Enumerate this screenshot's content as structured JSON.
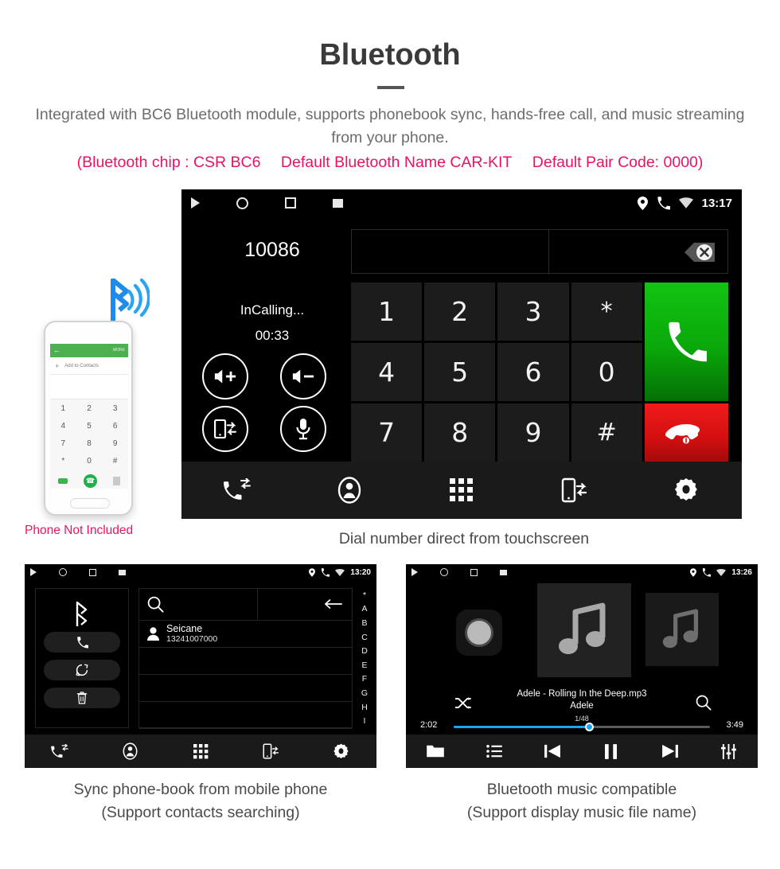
{
  "header": {
    "title": "Bluetooth",
    "subtitle": "Integrated with BC6 Bluetooth module, supports phonebook sync, hands-free call, and music streaming from your phone.",
    "spec_open": "(Bluetooth chip : CSR BC6",
    "spec_name": "Default Bluetooth Name CAR-KIT",
    "spec_pair": "Default Pair Code: 0000)",
    "accent_color": "#ec1164",
    "text_color": "#6d6d6d"
  },
  "captions": {
    "main": "Dial number direct from touchscreen",
    "phone_not_included": "Phone Not Included",
    "left_line1": "Sync phone-book from mobile phone",
    "left_line2": "(Support contacts searching)",
    "right_line1": "Bluetooth music compatible",
    "right_line2": "(Support display music file name)"
  },
  "dialer": {
    "status": {
      "time": "13:17",
      "icons": [
        "back-icon",
        "home-icon",
        "recents-icon",
        "screenshot-icon"
      ],
      "tray": [
        "location-icon",
        "phone-icon",
        "wifi-icon"
      ]
    },
    "caller_number": "10086",
    "call_state": "InCalling...",
    "call_timer": "00:33",
    "controls": [
      {
        "name": "volume-up-button",
        "icon": "speaker-plus-icon"
      },
      {
        "name": "volume-down-button",
        "icon": "speaker-minus-icon"
      },
      {
        "name": "transfer-to-phone-button",
        "icon": "phone-transfer-icon"
      },
      {
        "name": "mute-microphone-button",
        "icon": "microphone-icon"
      }
    ],
    "input_value": "",
    "backspace_label": "backspace-icon",
    "keys": [
      "1",
      "2",
      "3",
      "*",
      "4",
      "5",
      "6",
      "0",
      "7",
      "8",
      "9",
      "#"
    ],
    "call_button": "call-icon",
    "end_button": "end-call-icon",
    "tabs": [
      {
        "name": "tab-call-log",
        "icon": "call-log-icon"
      },
      {
        "name": "tab-contacts",
        "icon": "contact-icon"
      },
      {
        "name": "tab-keypad",
        "icon": "keypad-icon"
      },
      {
        "name": "tab-sync",
        "icon": "sync-device-icon"
      },
      {
        "name": "tab-settings",
        "icon": "gear-icon"
      }
    ]
  },
  "phone_illustration": {
    "topbar_back": "back-arrow-icon",
    "topbar_more": "MORE",
    "add_contact": "Add to Contacts",
    "keys": [
      "1",
      "2",
      "3",
      "4",
      "5",
      "6",
      "7",
      "8",
      "9",
      "*",
      "0",
      "#"
    ],
    "bt_icon": "bluetooth-signal-icon"
  },
  "phonebook": {
    "status": {
      "time": "13:20",
      "icons": [
        "back-icon",
        "home-icon",
        "recents-icon",
        "screenshot-icon"
      ],
      "tray": [
        "location-icon",
        "phone-icon",
        "wifi-icon"
      ]
    },
    "side_buttons": [
      {
        "name": "bluetooth-status-icon",
        "icon": "bluetooth-icon"
      },
      {
        "name": "dial-button",
        "icon": "phone-icon"
      },
      {
        "name": "sync-contacts-button",
        "icon": "refresh-icon"
      },
      {
        "name": "delete-contacts-button",
        "icon": "trash-icon"
      }
    ],
    "search_placeholder": "",
    "search_icon": "search-icon",
    "back_icon": "arrow-left-icon",
    "contacts": [
      {
        "name": "Seicane",
        "number": "13241007000"
      }
    ],
    "empty_rows": 3,
    "index": [
      "*",
      "A",
      "B",
      "C",
      "D",
      "E",
      "F",
      "G",
      "H",
      "I"
    ],
    "tabs": [
      {
        "name": "tab-call-log",
        "icon": "call-log-icon"
      },
      {
        "name": "tab-contacts",
        "icon": "contact-icon"
      },
      {
        "name": "tab-keypad",
        "icon": "keypad-icon"
      },
      {
        "name": "tab-sync",
        "icon": "sync-device-icon"
      },
      {
        "name": "tab-settings",
        "icon": "gear-icon"
      }
    ]
  },
  "music": {
    "status": {
      "time": "13:26",
      "icons": [
        "back-icon",
        "home-icon",
        "recents-icon",
        "screenshot-icon"
      ],
      "tray": [
        "location-icon",
        "phone-icon",
        "wifi-icon"
      ]
    },
    "track_title": "Adele - Rolling In the Deep.mp3",
    "artist": "Adele",
    "track_count": "1/48",
    "elapsed": "2:02",
    "total": "3:49",
    "progress_percent": 53,
    "progress_color": "#19a4f5",
    "shuffle_icon": "shuffle-icon",
    "search_icon": "search-icon",
    "tabs": [
      {
        "name": "tab-folder",
        "icon": "folder-icon"
      },
      {
        "name": "tab-playlist",
        "icon": "list-icon"
      },
      {
        "name": "tab-previous",
        "icon": "previous-icon"
      },
      {
        "name": "tab-play-pause",
        "icon": "pause-icon"
      },
      {
        "name": "tab-next",
        "icon": "next-icon"
      },
      {
        "name": "tab-equalizer",
        "icon": "equalizer-icon"
      }
    ]
  }
}
